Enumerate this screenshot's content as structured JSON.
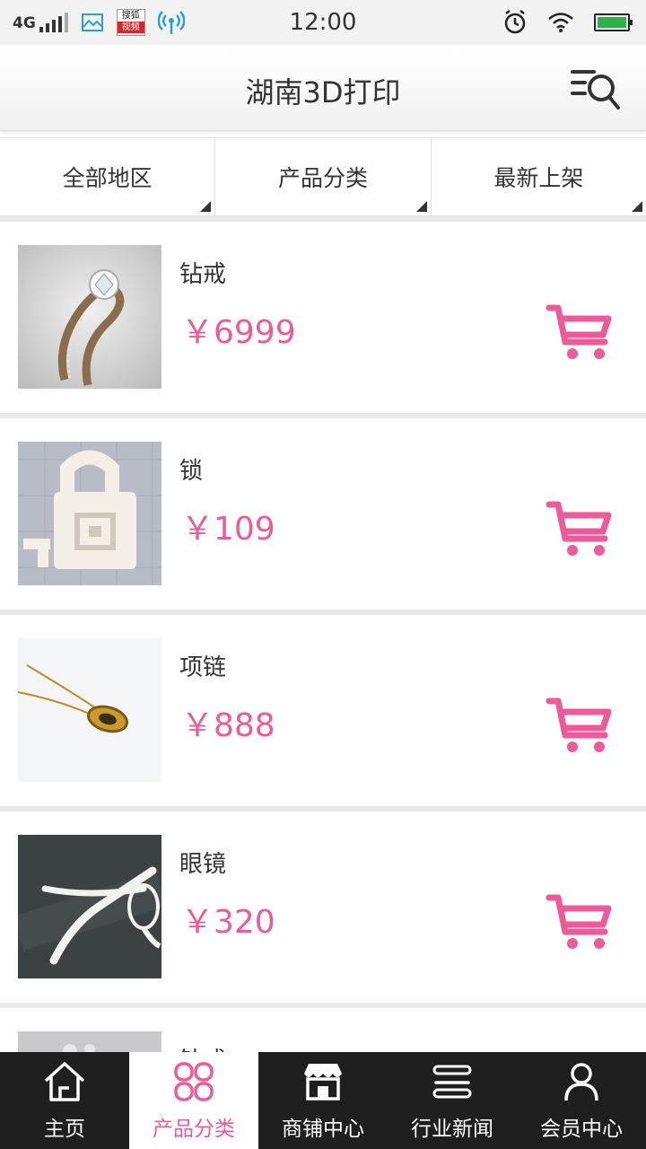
{
  "status_bar": {
    "network": "4G",
    "sohu_top": "搜狐",
    "sohu_bottom": "视频",
    "time": "12:00"
  },
  "header": {
    "title": "湖南3D打印",
    "search_icon": "list-search-icon"
  },
  "filters": [
    {
      "label": "全部地区"
    },
    {
      "label": "产品分类"
    },
    {
      "label": "最新上架"
    }
  ],
  "products": [
    {
      "name": "钻戒",
      "price": "￥6999",
      "image": "diamond-ring"
    },
    {
      "name": "锁",
      "price": "￥109",
      "image": "padlock"
    },
    {
      "name": "项链",
      "price": "￥888",
      "image": "necklace"
    },
    {
      "name": "眼镜",
      "price": "￥320",
      "image": "glasses"
    },
    {
      "name": "钻戒",
      "price": "",
      "image": "partial-item"
    }
  ],
  "bottom_nav": {
    "active_index": 1,
    "items": [
      {
        "label": "主页",
        "icon": "home-icon"
      },
      {
        "label": "产品分类",
        "icon": "category-icon"
      },
      {
        "label": "商铺中心",
        "icon": "store-icon"
      },
      {
        "label": "行业新闻",
        "icon": "news-icon"
      },
      {
        "label": "会员中心",
        "icon": "member-icon"
      }
    ]
  },
  "colors": {
    "accent": "#ed5a99",
    "nav_background": "#1f1f1f",
    "divider": "#e8e8e8"
  }
}
